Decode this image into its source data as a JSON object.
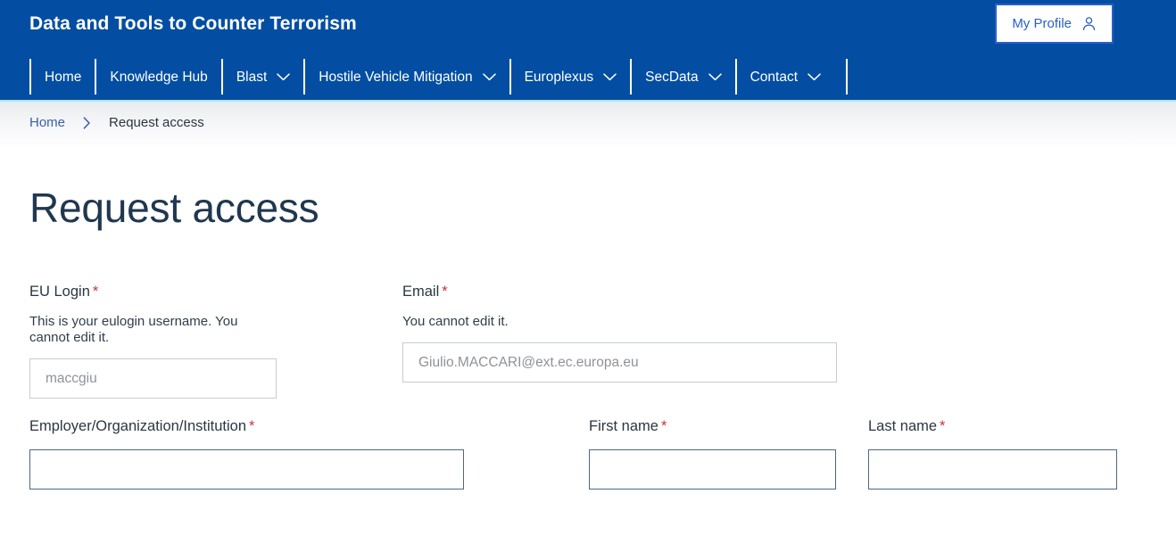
{
  "header": {
    "site_title": "Data and Tools to Counter Terrorism",
    "profile_button_label": "My Profile",
    "profile_icon": "person-icon",
    "accent_color": "#034EA2"
  },
  "nav": {
    "items": [
      {
        "label": "Home",
        "has_dropdown": false
      },
      {
        "label": "Knowledge Hub",
        "has_dropdown": false
      },
      {
        "label": "Blast",
        "has_dropdown": true
      },
      {
        "label": "Hostile Vehicle Mitigation",
        "has_dropdown": true
      },
      {
        "label": "Europlexus",
        "has_dropdown": true
      },
      {
        "label": "SecData",
        "has_dropdown": true
      },
      {
        "label": "Contact",
        "has_dropdown": true
      }
    ]
  },
  "breadcrumb": {
    "home_label": "Home",
    "separator_icon": "chevron-right-icon",
    "current_label": "Request access"
  },
  "main": {
    "page_title": "Request access",
    "required_mark": "*",
    "fields": {
      "eu_login": {
        "label": "EU Login",
        "required": true,
        "help": "This is your eulogin username. You cannot edit it.",
        "value": "",
        "placeholder": "maccgiu",
        "state": "disabled"
      },
      "email": {
        "label": "Email",
        "required": true,
        "help": "You cannot edit it.",
        "value": "",
        "placeholder": "Giulio.MACCARI@ext.ec.europa.eu",
        "state": "disabled"
      },
      "employer": {
        "label": "Employer/Organization/Institution",
        "required": true,
        "value": "",
        "placeholder": "",
        "state": "active"
      },
      "first_name": {
        "label": "First name",
        "required": true,
        "value": "",
        "placeholder": "",
        "state": "active"
      },
      "last_name": {
        "label": "Last name",
        "required": true,
        "value": "",
        "placeholder": "",
        "state": "active"
      }
    }
  },
  "colors": {
    "header_blue": "#034EA2",
    "link_blue": "#3b5fa8",
    "title_navy": "#20374f",
    "required_red": "#c6343c",
    "active_border": "#4e6782",
    "disabled_border": "#c9ccd1"
  }
}
